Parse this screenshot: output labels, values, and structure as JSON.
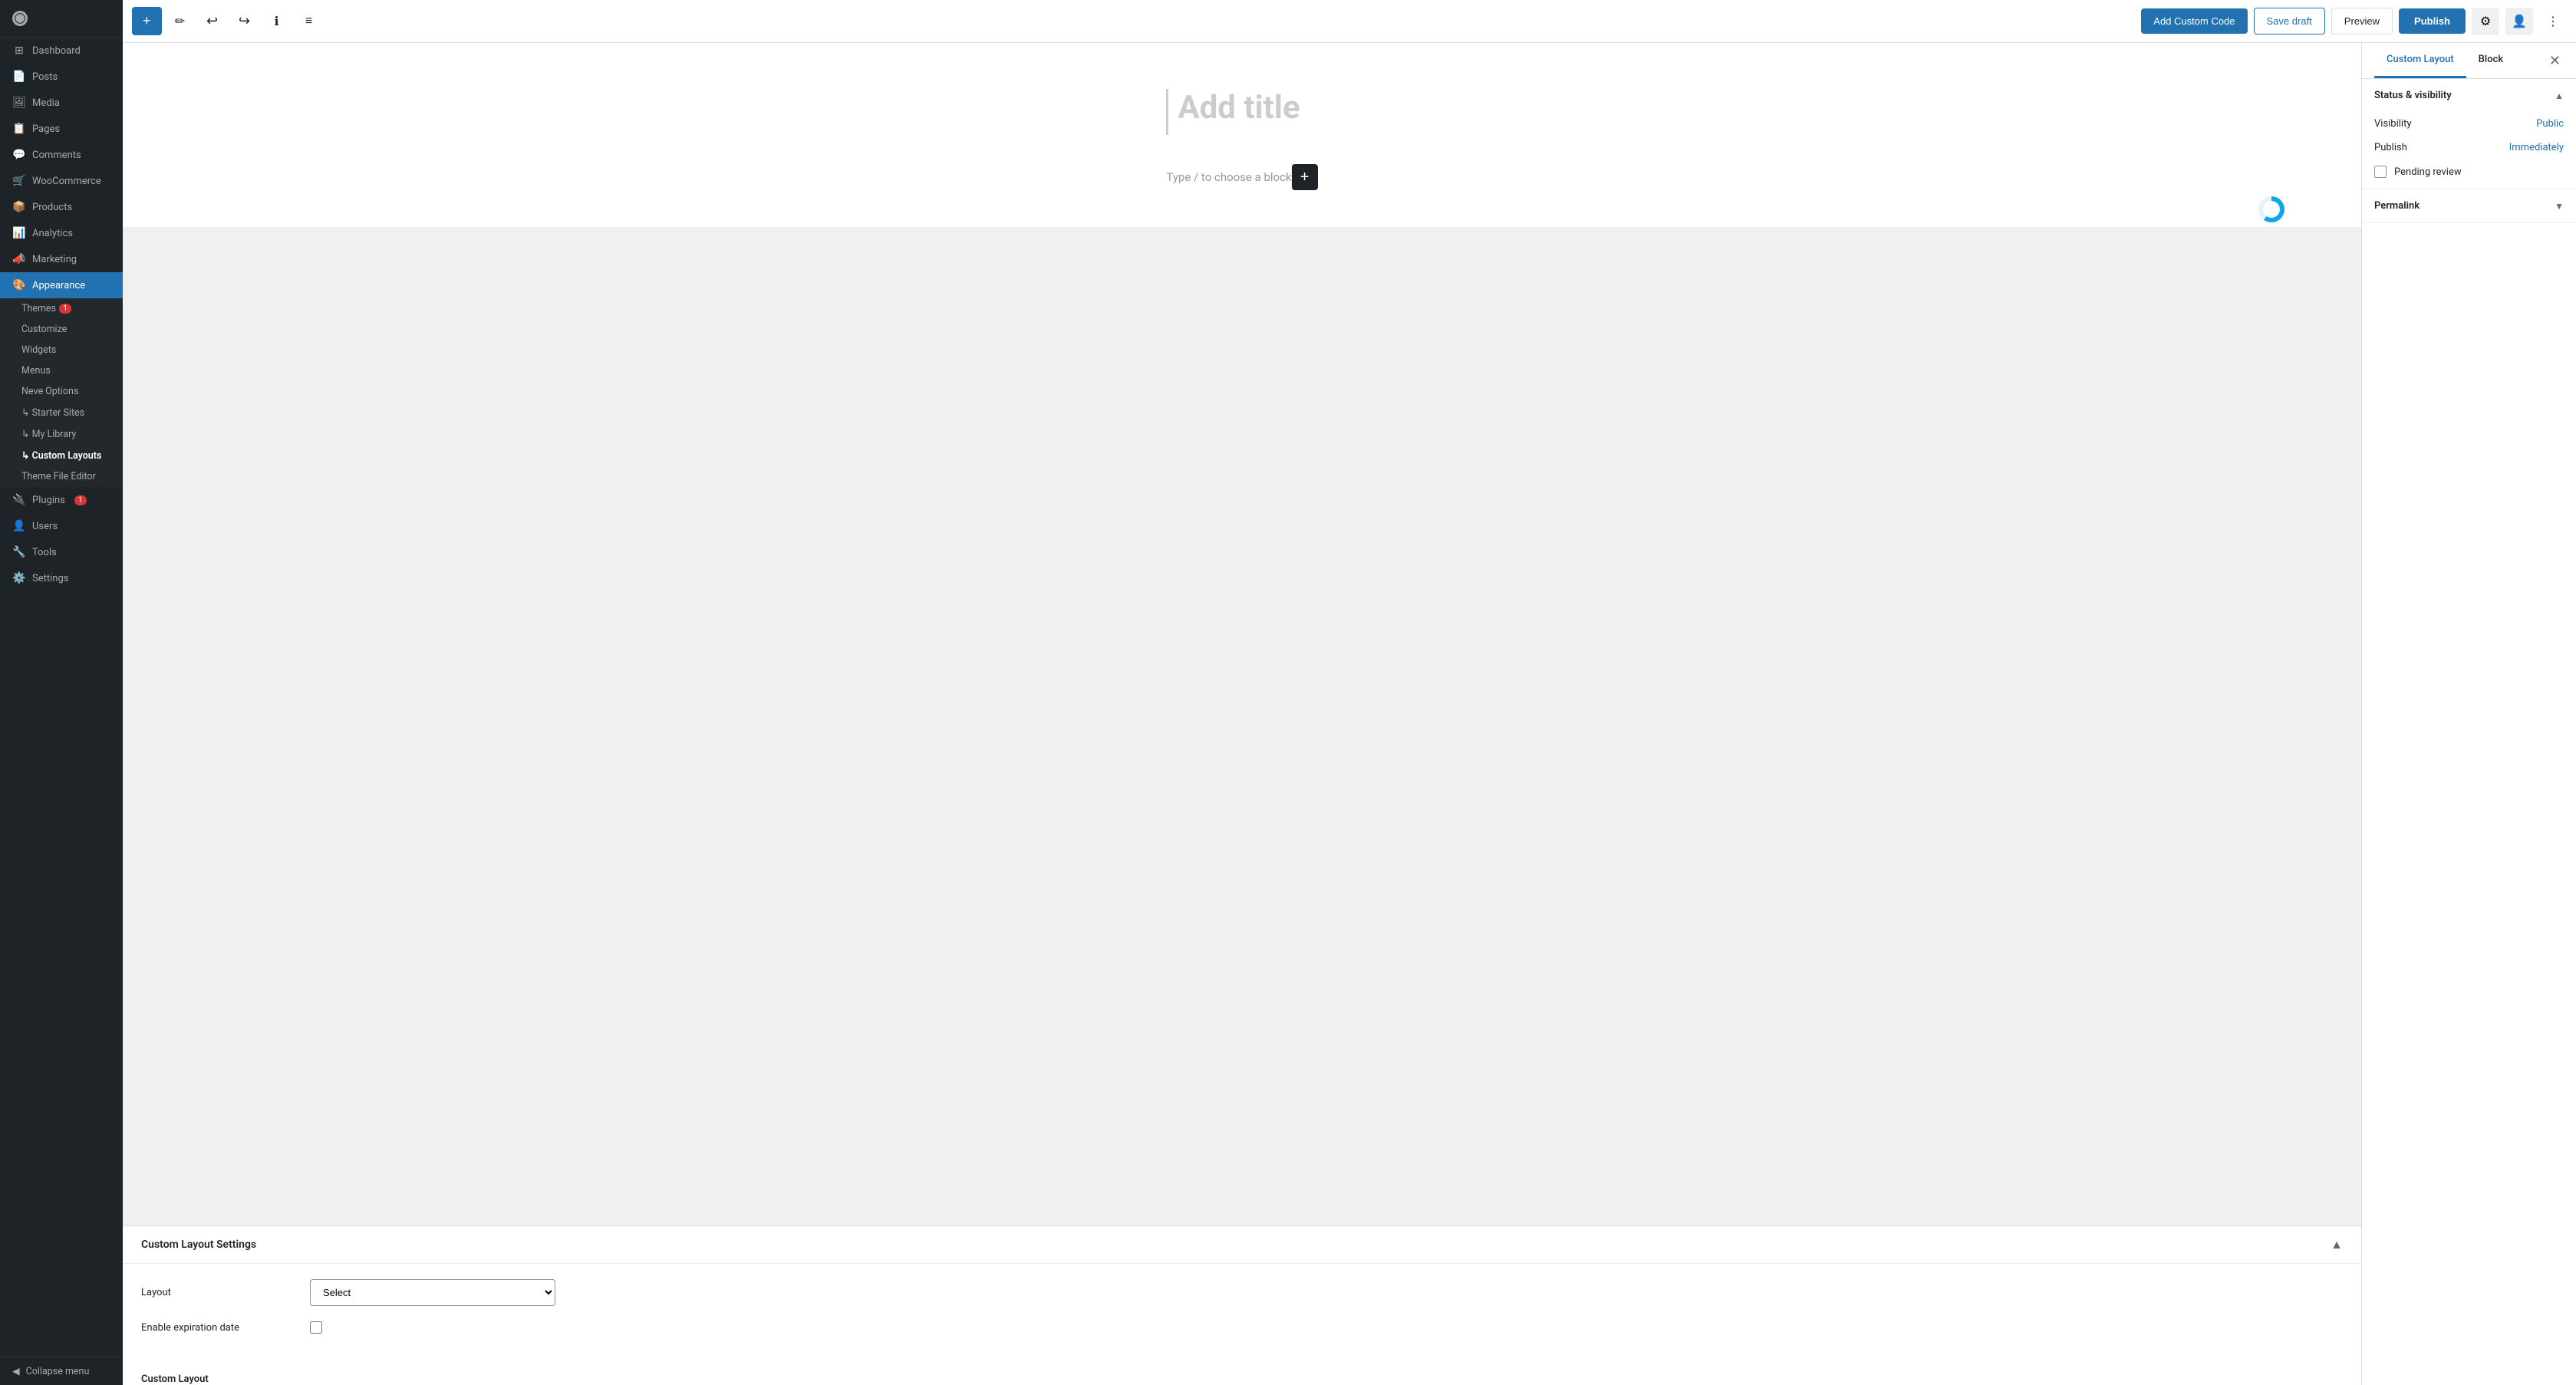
{
  "sidebar": {
    "items": [
      {
        "id": "dashboard",
        "label": "Dashboard",
        "icon": "⊞"
      },
      {
        "id": "posts",
        "label": "Posts",
        "icon": "📄"
      },
      {
        "id": "media",
        "label": "Media",
        "icon": "🖼"
      },
      {
        "id": "pages",
        "label": "Pages",
        "icon": "📋"
      },
      {
        "id": "comments",
        "label": "Comments",
        "icon": "💬"
      },
      {
        "id": "woocommerce",
        "label": "WooCommerce",
        "icon": "🛒"
      },
      {
        "id": "products",
        "label": "Products",
        "icon": "📦"
      },
      {
        "id": "analytics",
        "label": "Analytics",
        "icon": "📊"
      },
      {
        "id": "marketing",
        "label": "Marketing",
        "icon": "📣"
      },
      {
        "id": "appearance",
        "label": "Appearance",
        "icon": "🎨",
        "active": true
      }
    ],
    "submenu": [
      {
        "id": "themes",
        "label": "Themes",
        "badge": 1
      },
      {
        "id": "customize",
        "label": "Customize"
      },
      {
        "id": "widgets",
        "label": "Widgets"
      },
      {
        "id": "menus",
        "label": "Menus"
      },
      {
        "id": "neve-options",
        "label": "Neve Options"
      },
      {
        "id": "starter-sites",
        "label": "↳ Starter Sites"
      },
      {
        "id": "my-library",
        "label": "↳ My Library"
      },
      {
        "id": "custom-layouts",
        "label": "↳ Custom Layouts",
        "active": true
      },
      {
        "id": "theme-file-editor",
        "label": "Theme File Editor"
      }
    ],
    "other_items": [
      {
        "id": "plugins",
        "label": "Plugins",
        "icon": "🔌",
        "badge": 1
      },
      {
        "id": "users",
        "label": "Users",
        "icon": "👤"
      },
      {
        "id": "tools",
        "label": "Tools",
        "icon": "🔧"
      },
      {
        "id": "settings",
        "label": "Settings",
        "icon": "⚙️"
      }
    ],
    "collapse_label": "Collapse menu"
  },
  "toolbar": {
    "add_label": "+",
    "edit_label": "✏",
    "undo_label": "↩",
    "redo_label": "↪",
    "info_label": "ℹ",
    "list_label": "≡",
    "add_custom_code_label": "Add Custom Code",
    "save_draft_label": "Save draft",
    "preview_label": "Preview",
    "publish_label": "Publish"
  },
  "editor": {
    "title_placeholder": "Add title",
    "block_placeholder": "Type / to choose a block"
  },
  "right_panel": {
    "tab_custom_layout": "Custom Layout",
    "tab_block": "Block",
    "sections": {
      "status_visibility": {
        "title": "Status & visibility",
        "visibility_label": "Visibility",
        "visibility_value": "Public",
        "publish_label": "Publish",
        "publish_value": "Immediately",
        "pending_review_label": "Pending review"
      },
      "permalink": {
        "title": "Permalink"
      }
    }
  },
  "settings_panel": {
    "title": "Custom Layout Settings",
    "layout_label": "Layout",
    "layout_placeholder": "Select",
    "expiration_label": "Enable expiration date",
    "custom_layout_title": "Custom Layout"
  }
}
